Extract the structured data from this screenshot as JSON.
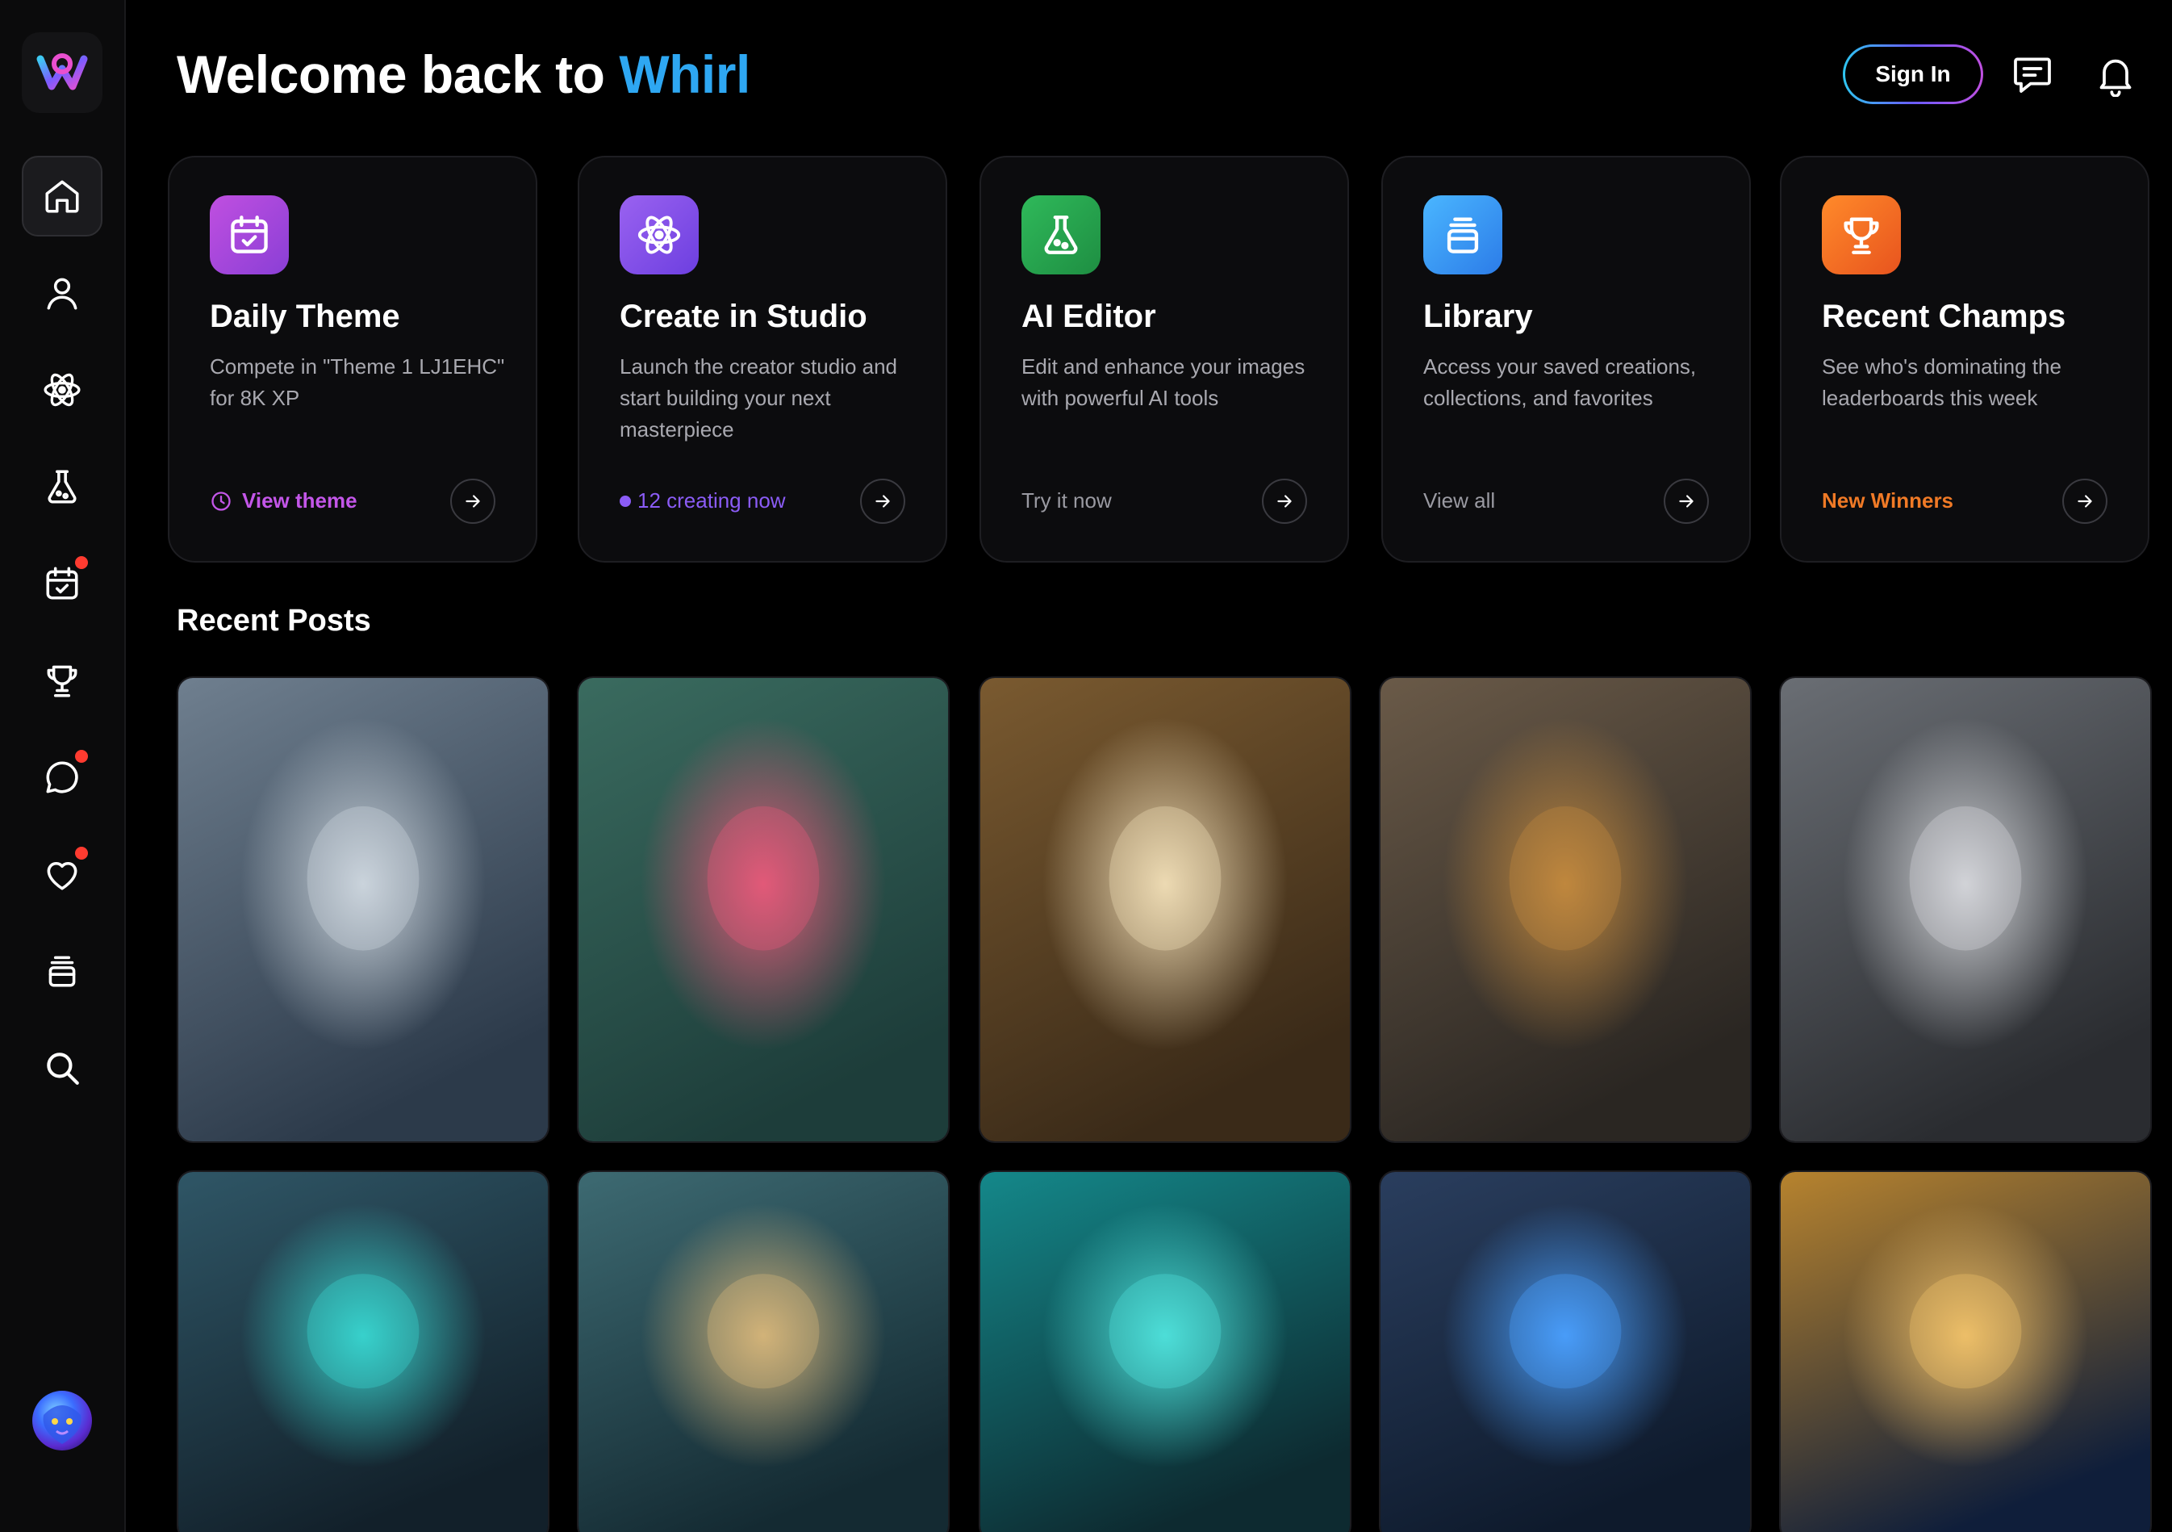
{
  "app": {
    "title_prefix": "Welcome back to",
    "brand": "Whirl",
    "brand_color": "#2ea7f2"
  },
  "header": {
    "sign_in_label": "Sign In",
    "icons": [
      "messages-icon",
      "bell-icon"
    ]
  },
  "sidebar": {
    "logo": "whirl-logo",
    "items": [
      {
        "icon": "home-icon",
        "active": true,
        "badge": false
      },
      {
        "icon": "profile-icon",
        "active": false,
        "badge": false
      },
      {
        "icon": "atom-icon",
        "active": false,
        "badge": false
      },
      {
        "icon": "flask-icon",
        "active": false,
        "badge": false
      },
      {
        "icon": "calendar-check-icon",
        "active": false,
        "badge": true
      },
      {
        "icon": "trophy-icon",
        "active": false,
        "badge": false
      },
      {
        "icon": "chat-bubble-icon",
        "active": false,
        "badge": true
      },
      {
        "icon": "heart-icon",
        "active": false,
        "badge": true
      },
      {
        "icon": "library-icon",
        "active": false,
        "badge": false
      },
      {
        "icon": "search-icon",
        "active": false,
        "badge": false
      }
    ],
    "avatar": "user-avatar"
  },
  "cards": [
    {
      "title": "Daily Theme",
      "description": "Compete in \"Theme 1 LJ1EHC\" for 8K XP",
      "footer": "View theme",
      "footer_color": "#c356e8",
      "icon": "calendar-check-icon",
      "icon_colors": [
        "#c04fe0",
        "#8a3fd6"
      ]
    },
    {
      "title": "Create in Studio",
      "description": "Launch the creator studio and start building your next masterpiece",
      "footer": "12 creating now",
      "footer_color": "#8b5cf6",
      "icon": "atom-icon",
      "icon_colors": [
        "#9a62f0",
        "#6d3fe0"
      ]
    },
    {
      "title": "AI Editor",
      "description": "Edit and enhance your images with powerful AI tools",
      "footer": "Try it now",
      "footer_color": "#9a9aa2",
      "icon": "flask-icon",
      "icon_colors": [
        "#2fb95a",
        "#1e8e42"
      ]
    },
    {
      "title": "Library",
      "description": "Access your saved creations, collections, and favorites",
      "footer": "View all",
      "footer_color": "#9a9aa2",
      "icon": "library-icon",
      "icon_colors": [
        "#4ab6ff",
        "#2c7ce8"
      ]
    },
    {
      "title": "Recent Champs",
      "description": "See who's dominating the leaderboards this week",
      "footer": "New Winners",
      "footer_color": "#f07a26",
      "icon": "trophy-icon",
      "icon_colors": [
        "#ff8a2a",
        "#e8541e"
      ]
    }
  ],
  "recent_posts": {
    "title": "Recent Posts",
    "posts": [
      {
        "name": "crystal-dragon-post",
        "colors": [
          "#2c3a4a",
          "#6f7f8f",
          "#cfd8e0"
        ]
      },
      {
        "name": "rainbow-owl-post",
        "colors": [
          "#1d3d3a",
          "#3a6b5f",
          "#e85a7a"
        ]
      },
      {
        "name": "glass-lynx-post",
        "colors": [
          "#3a2a18",
          "#7a5a30",
          "#f2dfb8"
        ]
      },
      {
        "name": "violin-lion-post",
        "colors": [
          "#2a2622",
          "#6a5a48",
          "#c48a3e"
        ]
      },
      {
        "name": "silver-warrior-post",
        "colors": [
          "#2a2c30",
          "#6a6e74",
          "#d6d8dc"
        ]
      },
      {
        "name": "dragon-knight-post",
        "colors": [
          "#12202a",
          "#2f5666",
          "#38d6d0"
        ]
      },
      {
        "name": "mermaid-queen-post",
        "colors": [
          "#142a32",
          "#3d6a72",
          "#d8b67a"
        ]
      },
      {
        "name": "sea-parting-post",
        "colors": [
          "#0d2a30",
          "#14888a",
          "#4fe3dc"
        ]
      },
      {
        "name": "ice-armor-post",
        "colors": [
          "#0e1a2c",
          "#2a3e5e",
          "#4aa0ff"
        ]
      },
      {
        "name": "moon-god-post",
        "colors": [
          "#0f1e3a",
          "#b7832e",
          "#f2c26a"
        ]
      }
    ]
  }
}
